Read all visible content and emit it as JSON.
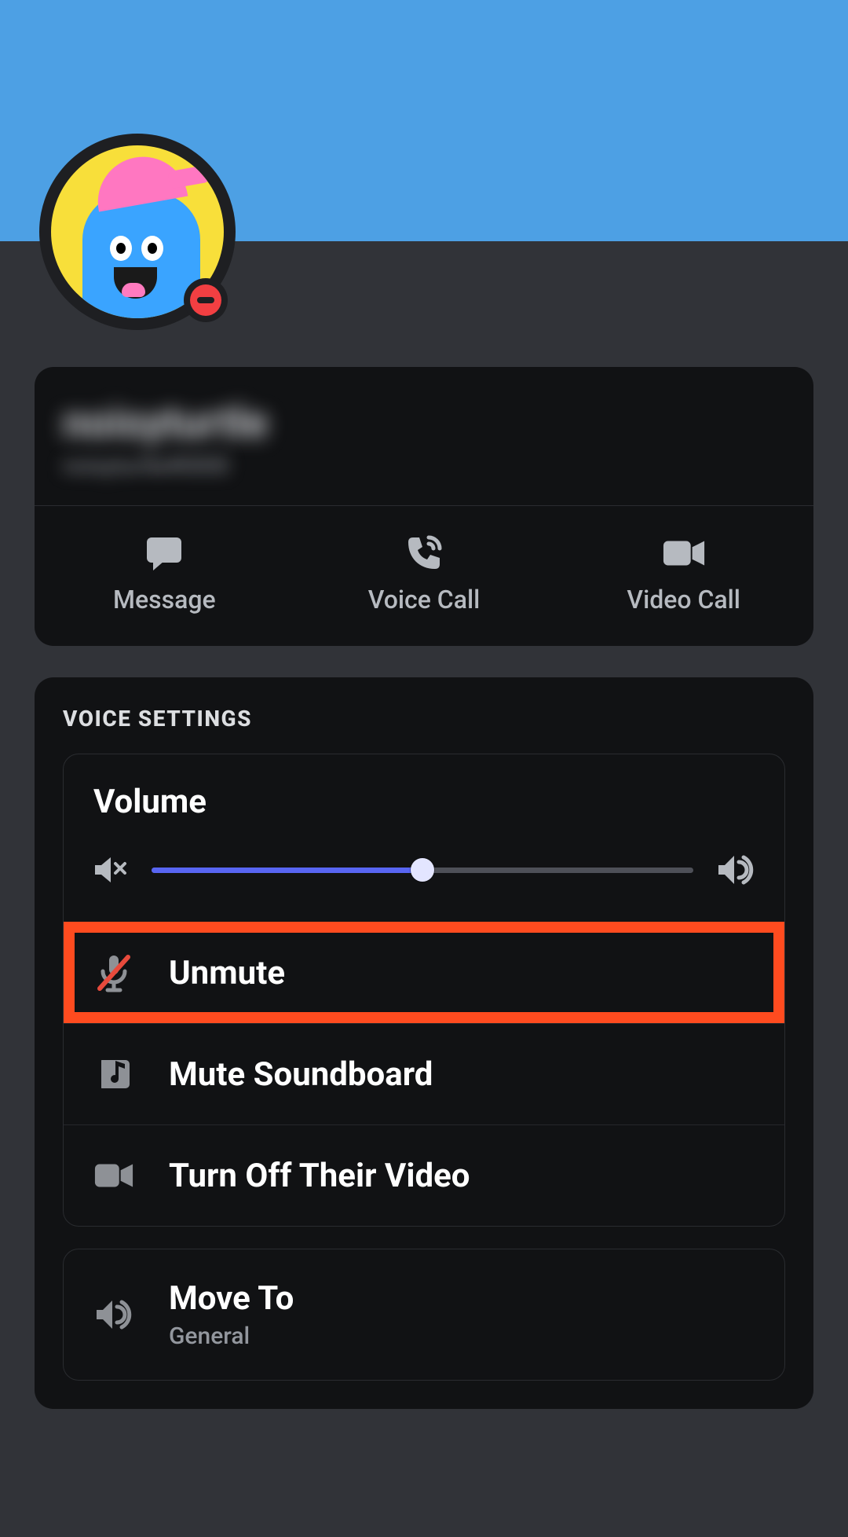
{
  "profile": {
    "display_name": "noisyturtle",
    "username_tag": "noisyturtle#0000",
    "status": "dnd",
    "banner_color": "#4da0e4"
  },
  "actions": {
    "message": "Message",
    "voice_call": "Voice Call",
    "video_call": "Video Call"
  },
  "voice_settings": {
    "section_title": "VOICE SETTINGS",
    "volume_label": "Volume",
    "volume_percent": 50,
    "unmute": "Unmute",
    "mute_soundboard": "Mute Soundboard",
    "turn_off_video": "Turn Off Their Video"
  },
  "move_to": {
    "label": "Move To",
    "channel": "General"
  }
}
